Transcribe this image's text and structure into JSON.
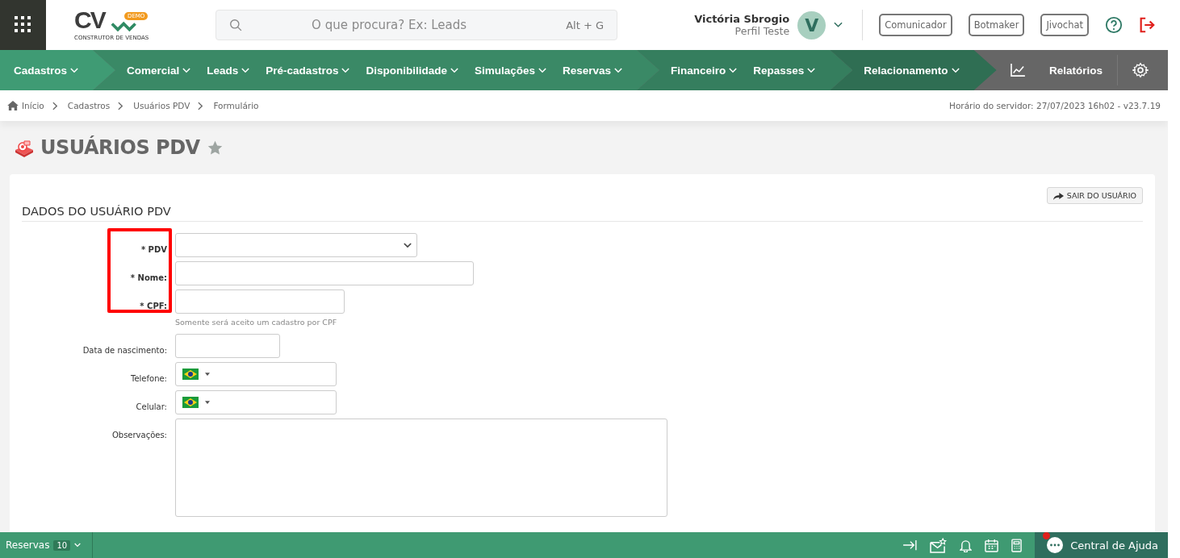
{
  "header": {
    "logo_text": "CV",
    "logo_badge": "DEMO",
    "logo_caption": "CONSTRUTOR DE VENDAS",
    "search": {
      "placeholder": "O que procura? Ex: Leads",
      "shortcut": "Alt + G"
    },
    "user": {
      "name": "Victória Sbrogio",
      "profile": "Perfil Teste",
      "initial": "V"
    },
    "buttons": [
      "Comunicador",
      "Botmaker",
      "Jivochat"
    ]
  },
  "nav": {
    "groups": [
      {
        "items": [
          "Cadastros"
        ]
      },
      {
        "items": [
          "Comercial",
          "Leads",
          "Pré-cadastros",
          "Disponibilidade",
          "Simulações",
          "Reservas"
        ]
      },
      {
        "items": [
          "Financeiro",
          "Repasses"
        ]
      },
      {
        "items": [
          "Relacionamento"
        ]
      }
    ],
    "reports": "Relatórios"
  },
  "breadcrumb": [
    "Início",
    "Cadastros",
    "Usuários PDV",
    "Formulário"
  ],
  "server_time": "Horário do servidor: 27/07/2023 16h02 - v23.7.19",
  "page_title": "USUÁRIOS PDV",
  "favorite": false,
  "exit_button": "SAIR DO USUÁRIO",
  "section_title": "DADOS DO USUÁRIO PDV",
  "form": {
    "fields": [
      {
        "label": "* PDV",
        "kind": "select",
        "highlighted": true
      },
      {
        "label": "* Nome:",
        "kind": "text",
        "highlighted": true
      },
      {
        "label": "* CPF:",
        "kind": "text",
        "highlighted": true,
        "hint": "Somente será aceito um cadastro por CPF"
      },
      {
        "label": "Data de nascimento:",
        "kind": "text",
        "highlighted": false
      },
      {
        "label": "Telefone:",
        "kind": "phone",
        "highlighted": false
      },
      {
        "label": "Celular:",
        "kind": "phone",
        "highlighted": false
      },
      {
        "label": "Observações:",
        "kind": "textarea",
        "highlighted": false
      }
    ]
  },
  "footer": {
    "label": "Reservas",
    "count": "10",
    "help": "Central de Ajuda",
    "help_notification": true
  }
}
